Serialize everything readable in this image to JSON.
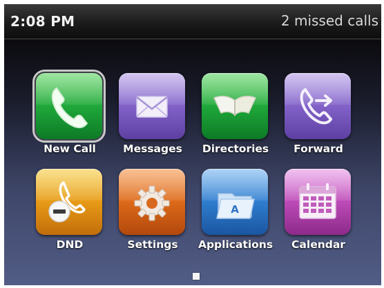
{
  "status_bar": {
    "time": "2:08 PM",
    "notification": "2 missed calls"
  },
  "apps": [
    {
      "label": "New Call",
      "icon": "phone-handset-icon",
      "color": "#1fa83a",
      "selected": true
    },
    {
      "label": "Messages",
      "icon": "envelope-icon",
      "color": "#8262c8"
    },
    {
      "label": "Directories",
      "icon": "open-book-icon",
      "color": "#1fa83a"
    },
    {
      "label": "Forward",
      "icon": "call-forward-icon",
      "color": "#8262c8"
    },
    {
      "label": "DND",
      "icon": "do-not-disturb-icon",
      "color": "#e79a16"
    },
    {
      "label": "Settings",
      "icon": "gear-icon",
      "color": "#dd6a1a"
    },
    {
      "label": "Applications",
      "icon": "applications-folder-icon",
      "color": "#2f7dcf"
    },
    {
      "label": "Calendar",
      "icon": "calendar-icon",
      "color": "#bd4bb7"
    }
  ],
  "pager": {
    "pages": 1,
    "current": 1
  }
}
